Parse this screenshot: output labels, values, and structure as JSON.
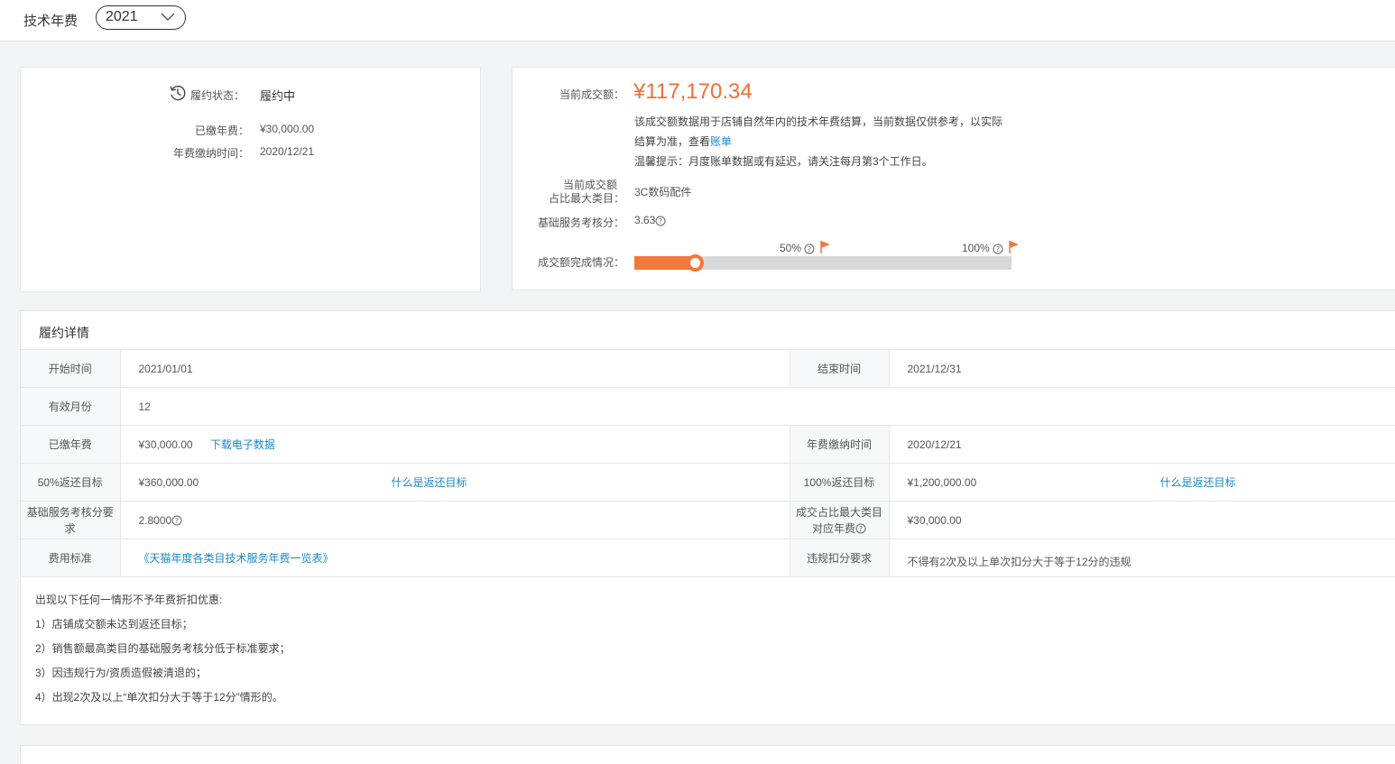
{
  "header": {
    "title": "技术年费",
    "year": "2021"
  },
  "status_panel": {
    "status_label": "履约状态：",
    "status_value": "履约中",
    "paid_label": "已缴年费：",
    "paid_value": "¥30,000.00",
    "paytime_label": "年费缴纳时间：",
    "paytime_value": "2020/12/21"
  },
  "deal_panel": {
    "amount_label": "当前成交额：",
    "amount_value": "¥117,170.34",
    "note_line1": "该成交额数据用于店铺自然年内的技术年费结算，当前数据仅供参考，以实际",
    "note_line2": "结算为准，查看",
    "bill_link": "账单",
    "tip": "温馨提示：月度账单数据或有延迟，请关注每月第3个工作日。",
    "category_label_1": "当前成交额",
    "category_label_2": "占比最大类目：",
    "category_value": "3C数码配件",
    "score_label": "基础服务考核分：",
    "score_value": "3.63",
    "progress_label": "成交额完成情况：",
    "progress_fraction": 0.16,
    "marker_50": "50%",
    "marker_100": "100%"
  },
  "detail": {
    "title": "履约详情",
    "start_label": "开始时间",
    "start_value": "2021/01/01",
    "end_label": "结束时间",
    "end_value": "2021/12/31",
    "months_label": "有效月份",
    "months_value": "12",
    "paid_label": "已缴年费",
    "paid_value": "¥30,000.00",
    "download_link": "下载电子数据",
    "paytime_label": "年费缴纳时间",
    "paytime_value": "2020/12/21",
    "target50_label": "50%返还目标",
    "target50_value": "¥360,000.00",
    "target_help_link": "什么是返还目标",
    "target100_label": "100%返还目标",
    "target100_value": "¥1,200,000.00",
    "score_req_label_1": "基础服务考核分要",
    "score_req_label_2": "求",
    "score_req_value": "2.8000",
    "cat_fee_label_1": "成交占比最大类目",
    "cat_fee_label_2": "对应年费",
    "cat_fee_value": "¥30,000.00",
    "fee_std_label": "费用标准",
    "fee_std_link": "《天猫年度各类目技术服务年费一览表》",
    "violation_label": "违规扣分要求",
    "violation_value": "不得有2次及以上单次扣分大于等于12分的违规"
  },
  "rules": {
    "intro": "出现以下任何一情形不予年费折扣优惠:",
    "items": [
      "1）店铺成交额未达到返还目标；",
      "2）销售额最高类目的基础服务考核分低于标准要求；",
      "3）因违规行为/资质造假被清退的；",
      "4）出现2次及以上“单次扣分大于等于12分”情形的。"
    ]
  },
  "colors": {
    "accent": "#f07034",
    "progress": "#f4773c",
    "link": "#1a88c9"
  }
}
